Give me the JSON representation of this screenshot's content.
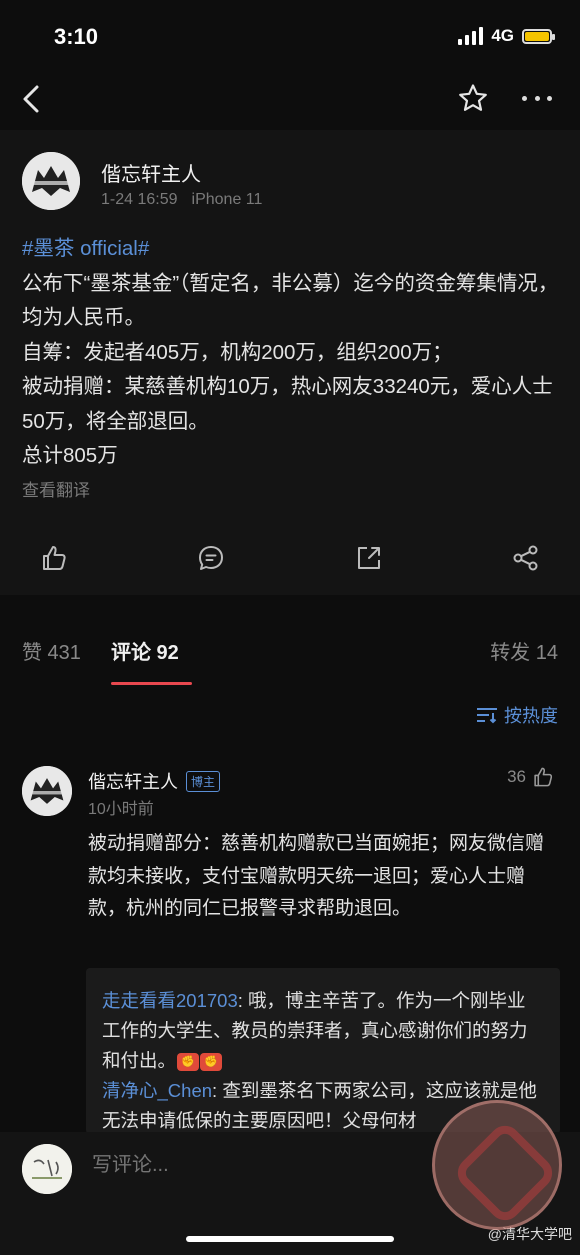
{
  "status": {
    "time": "3:10",
    "network": "4G"
  },
  "post": {
    "author": "偕忘轩主人",
    "date": "1-24 16:59",
    "device": "iPhone 11",
    "hashtag": "#墨茶 official#",
    "lines": [
      "公布下“墨茶基金”（暂定名，非公募）迄今的资金筹集情况，均为人民币。",
      "自筹：发起者405万，机构200万，组织200万；",
      "被动捐赠：某慈善机构10万，热心网友33240元，爱心人士50万，将全部退回。",
      "总计805万"
    ],
    "translate": "查看翻译"
  },
  "tabs": {
    "likes": "赞 431",
    "comments": "评论 92",
    "reposts": "转发 14"
  },
  "sort": {
    "label": "按热度"
  },
  "comment": {
    "author": "偕忘轩主人",
    "badge": "博主",
    "time": "10小时前",
    "likes": "36",
    "body": "被动捐赠部分：慈善机构赠款已当面婉拒；网友微信赠款均未接收，支付宝赠款明天统一退回；爱心人士赠款，杭州的同仁已报警寻求帮助退回。",
    "replies": [
      {
        "name": "走走看看201703",
        "text": "哦，博主辛苦了。作为一个刚毕业工作的大学生、教员的崇拜者，真心感谢你们的努力和付出。"
      },
      {
        "name": "清净心_Chen",
        "text": "查到墨茶名下两家公司，这应该就是他无法申请低保的主要原因吧！父母何材"
      }
    ]
  },
  "input": {
    "placeholder": "写评论..."
  },
  "watermark": "@清华大学吧",
  "colors": {
    "accent": "#5b8fd6",
    "tab_indicator": "#e8484f",
    "battery": "#f5c400"
  }
}
